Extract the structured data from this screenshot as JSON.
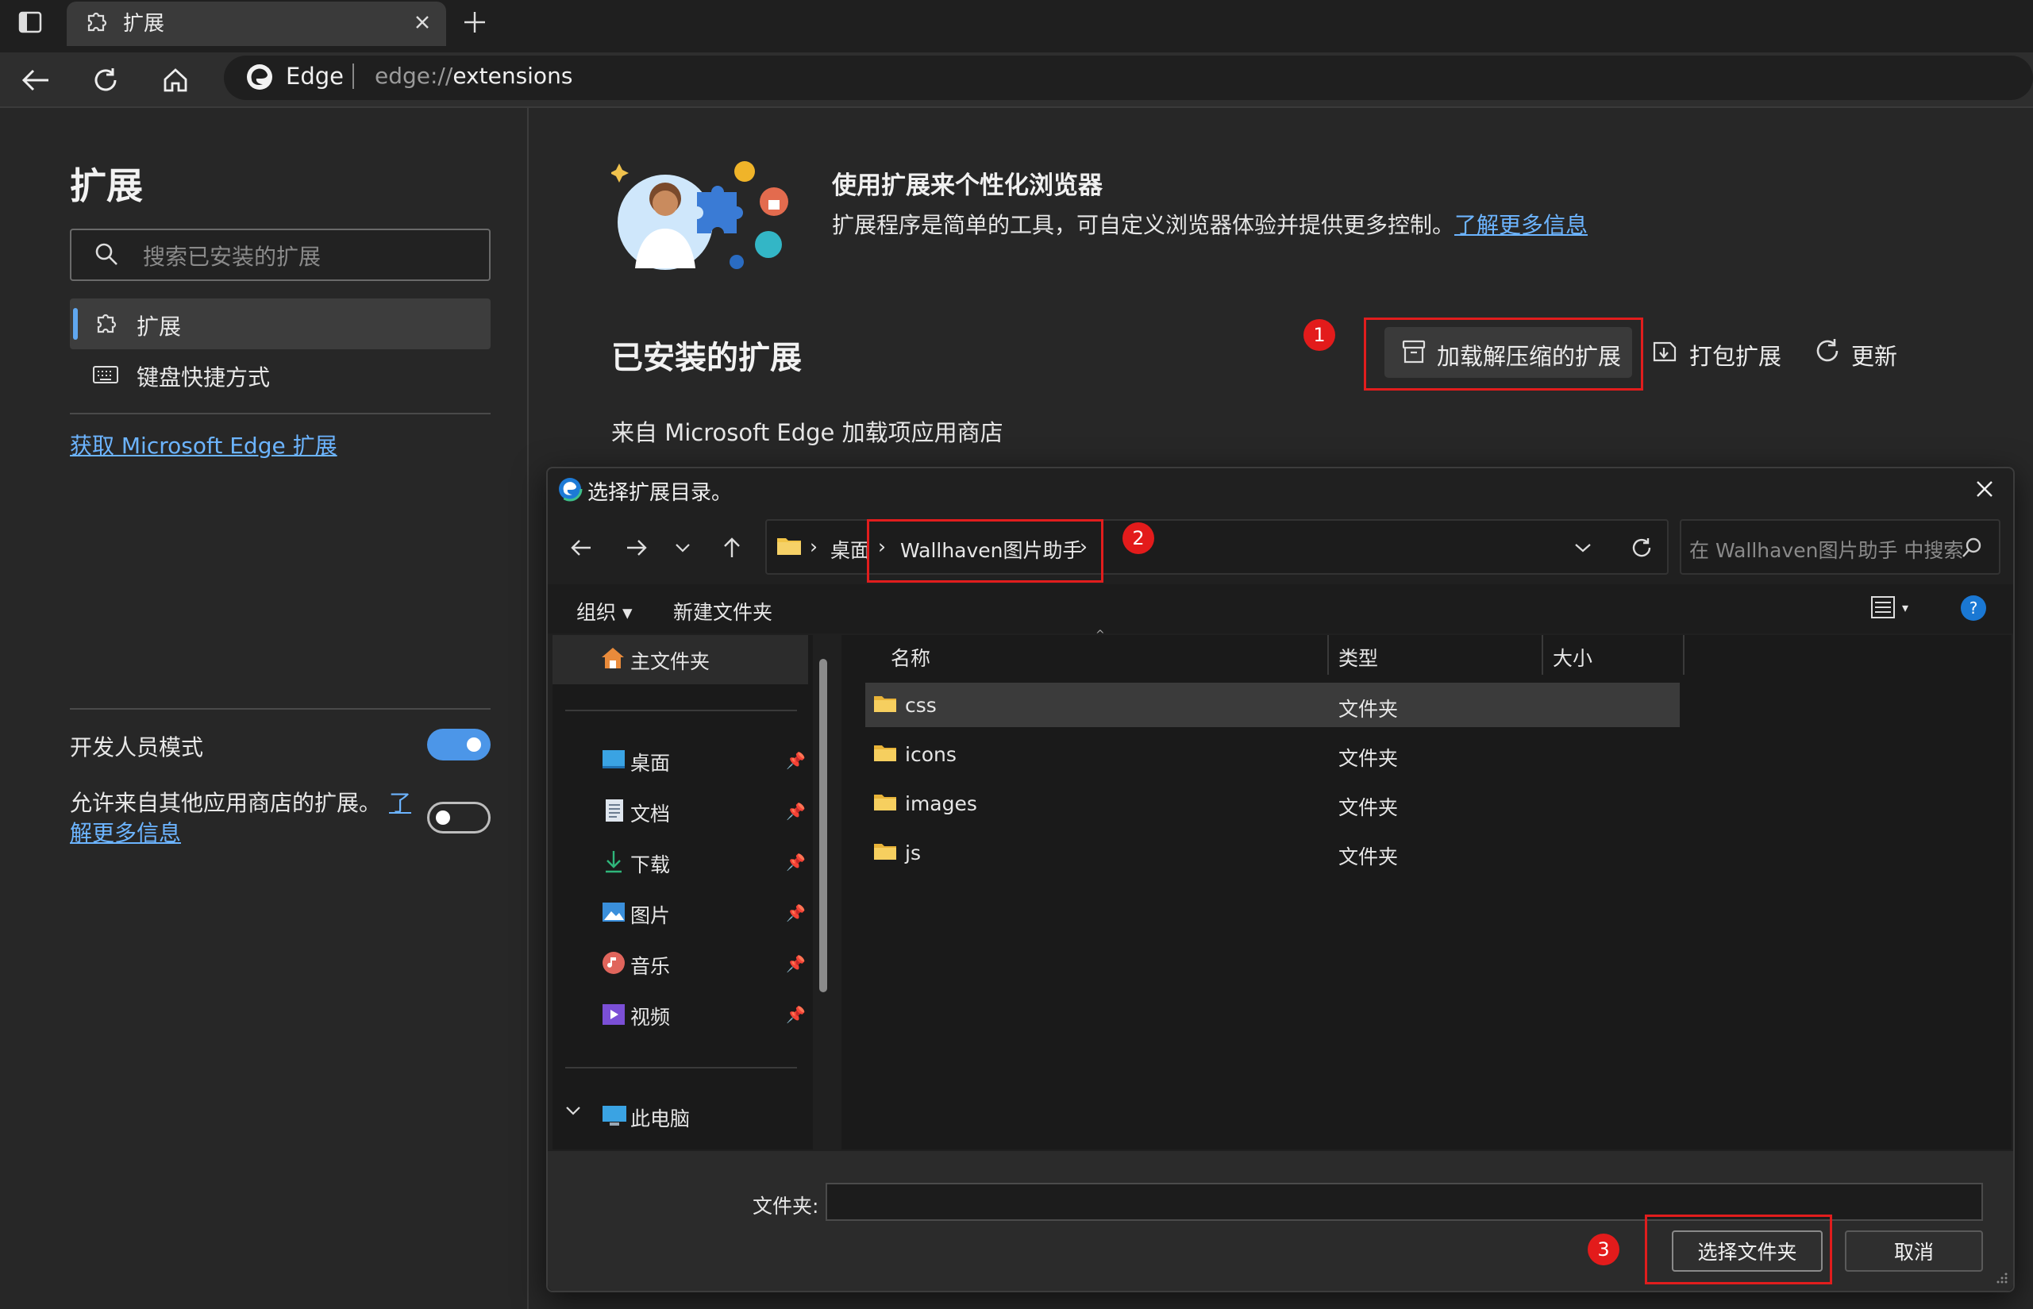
{
  "browser": {
    "tab_title": "扩展",
    "brand": "Edge",
    "url_prefix": "edge://",
    "url_path": "extensions"
  },
  "sidebar": {
    "title": "扩展",
    "search_placeholder": "搜索已安装的扩展",
    "items": [
      {
        "label": "扩展",
        "icon": "puzzle-icon",
        "active": true
      },
      {
        "label": "键盘快捷方式",
        "icon": "keyboard-icon",
        "active": false
      }
    ],
    "get_extensions_link": "获取 Microsoft Edge 扩展",
    "dev_mode_label": "开发人员模式",
    "dev_mode_on": true,
    "other_stores_label_line1": "允许来自其他应用商店的扩展。",
    "other_stores_link_a": "了",
    "other_stores_link_b": "解更多信息",
    "other_stores_on": false
  },
  "main": {
    "hero_title": "使用扩展来个性化浏览器",
    "hero_desc": "扩展程序是简单的工具，可自定义浏览器体验并提供更多控制。",
    "hero_link": "了解更多信息",
    "installed_title": "已安装的扩展",
    "actions": {
      "load_unpacked": "加载解压缩的扩展",
      "pack": "打包扩展",
      "update": "更新"
    },
    "store_source": "来自 Microsoft Edge 加载项应用商店"
  },
  "dialog": {
    "title": "选择扩展目录。",
    "breadcrumb": [
      "桌面",
      "Wallhaven图片助手"
    ],
    "search_placeholder": "在 Wallhaven图片助手 中搜索",
    "toolbar": {
      "organize": "组织",
      "new_folder": "新建文件夹"
    },
    "nav": {
      "home": "主文件夹",
      "quick": [
        {
          "label": "桌面",
          "icon": "desktop-icon"
        },
        {
          "label": "文档",
          "icon": "document-icon"
        },
        {
          "label": "下载",
          "icon": "download-icon"
        },
        {
          "label": "图片",
          "icon": "pictures-icon"
        },
        {
          "label": "音乐",
          "icon": "music-icon"
        },
        {
          "label": "视频",
          "icon": "video-icon"
        }
      ],
      "this_pc": "此电脑"
    },
    "columns": {
      "name": "名称",
      "type": "类型",
      "size": "大小"
    },
    "files": [
      {
        "name": "css",
        "type": "文件夹"
      },
      {
        "name": "icons",
        "type": "文件夹"
      },
      {
        "name": "images",
        "type": "文件夹"
      },
      {
        "name": "js",
        "type": "文件夹"
      }
    ],
    "folder_label": "文件夹:",
    "folder_value": "",
    "select_button": "选择文件夹",
    "cancel_button": "取消"
  },
  "annotations": [
    "1",
    "2",
    "3"
  ],
  "colors": {
    "accent": "#4c96e8",
    "annotation_red": "#e11d1d",
    "link": "#6cb4ff"
  }
}
